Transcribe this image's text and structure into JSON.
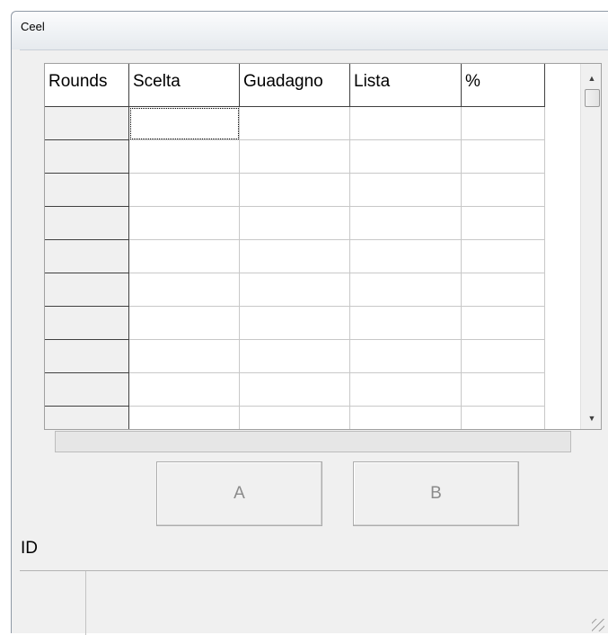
{
  "window": {
    "title": "Ceel"
  },
  "table": {
    "columns": [
      "Rounds",
      "Scelta",
      "Guadagno",
      "Lista",
      "%"
    ],
    "rows": [
      [
        "",
        "",
        "",
        "",
        ""
      ],
      [
        "",
        "",
        "",
        "",
        ""
      ],
      [
        "",
        "",
        "",
        "",
        ""
      ],
      [
        "",
        "",
        "",
        "",
        ""
      ],
      [
        "",
        "",
        "",
        "",
        ""
      ],
      [
        "",
        "",
        "",
        "",
        ""
      ],
      [
        "",
        "",
        "",
        "",
        ""
      ],
      [
        "",
        "",
        "",
        "",
        ""
      ],
      [
        "",
        "",
        "",
        "",
        ""
      ],
      [
        "",
        "",
        "",
        "",
        ""
      ]
    ],
    "scroll_up_icon": "arrow-up-icon",
    "scroll_down_icon": "arrow-down-icon"
  },
  "progress": {
    "value": 0
  },
  "buttons": {
    "a_label": "A",
    "b_label": "B"
  },
  "id_label": "ID",
  "statusbar": {
    "pane1": "",
    "pane2": ""
  }
}
